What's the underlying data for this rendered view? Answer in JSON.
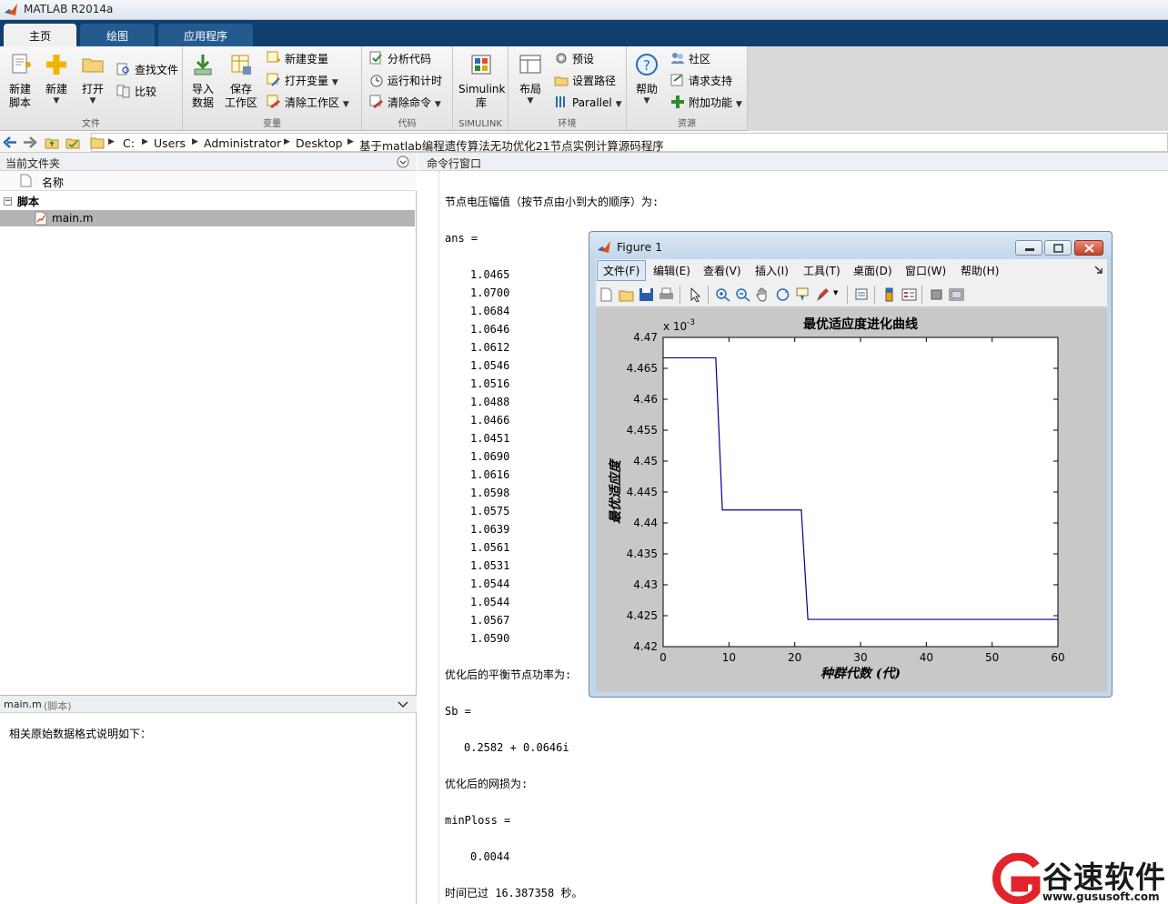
{
  "app": {
    "title": "MATLAB R2014a"
  },
  "tabs": [
    {
      "label": "主页",
      "active": true
    },
    {
      "label": "绘图",
      "active": false
    },
    {
      "label": "应用程序",
      "active": false
    }
  ],
  "ribbon": {
    "file": {
      "label": "文件",
      "new_script": [
        "新建",
        "脚本"
      ],
      "new": "新建",
      "open": "打开",
      "find_files": "查找文件",
      "compare": "比较"
    },
    "variable": {
      "label": "变量",
      "import": [
        "导入",
        "数据"
      ],
      "save_ws": [
        "保存",
        "工作区"
      ],
      "new_var": "新建变量",
      "open_var": "打开变量",
      "clear_ws": "清除工作区"
    },
    "code": {
      "label": "代码",
      "analyze": "分析代码",
      "run_time": "运行和计时",
      "clear_cmd": "清除命令"
    },
    "simulink": {
      "label": "SIMULINK",
      "btn": [
        "Simulink",
        "库"
      ]
    },
    "env": {
      "label": "环境",
      "layout": "布局",
      "prefs": "预设",
      "set_path": "设置路径",
      "parallel": "Parallel"
    },
    "resources": {
      "label": "资源",
      "help": "帮助",
      "community": "社区",
      "support": "请求支持",
      "addons": "附加功能"
    }
  },
  "address": {
    "crumbs": [
      "C:",
      "Users",
      "Administrator",
      "Desktop",
      "基于matlab编程遗传算法无功优化21节点实例计算源码程序"
    ]
  },
  "file_browser": {
    "title": "当前文件夹",
    "column_name": "名称",
    "group": "脚本",
    "file": "main.m"
  },
  "details": {
    "header_name": "main.m",
    "header_type": "(脚本)",
    "text": "相关原始数据格式说明如下："
  },
  "command_window": {
    "title": "命令行窗口",
    "heading": "节点电压幅值（按节点由小到大的顺序）为:",
    "ans_label": "ans =",
    "voltages": [
      "1.0465",
      "1.0700",
      "1.0684",
      "1.0646",
      "1.0612",
      "1.0546",
      "1.0516",
      "1.0488",
      "1.0466",
      "1.0451",
      "1.0690",
      "1.0616",
      "1.0598",
      "1.0575",
      "1.0639",
      "1.0561",
      "1.0531",
      "1.0544",
      "1.0544",
      "1.0567",
      "1.0590"
    ],
    "balance_heading": "优化后的平衡节点功率为:",
    "sb_label": "Sb =",
    "sb_value": "0.2582 + 0.0646i",
    "loss_heading": "优化后的网损为:",
    "loss_label": "minPloss =",
    "loss_value": "0.0044",
    "elapsed": "时间已过 16.387358 秒。"
  },
  "figure": {
    "title": "Figure 1",
    "menu": [
      "文件(F)",
      "编辑(E)",
      "查看(V)",
      "插入(I)",
      "工具(T)",
      "桌面(D)",
      "窗口(W)",
      "帮助(H)"
    ]
  },
  "chart_data": {
    "type": "line",
    "title": "最优适应度进化曲线",
    "xlabel": "种群代数 (代)",
    "ylabel": "最优适应度",
    "y_exponent_label": "x 10",
    "y_exponent": "-3",
    "xlim": [
      0,
      60
    ],
    "ylim": [
      4.42,
      4.47
    ],
    "xticks": [
      "0",
      "10",
      "20",
      "30",
      "40",
      "50",
      "60"
    ],
    "yticks": [
      "4.42",
      "4.425",
      "4.43",
      "4.435",
      "4.44",
      "4.445",
      "4.45",
      "4.455",
      "4.46",
      "4.465",
      "4.47"
    ],
    "series": [
      {
        "color": "#00008b",
        "x": [
          0,
          8,
          9,
          21,
          22,
          60
        ],
        "y": [
          4.4667,
          4.4667,
          4.4421,
          4.4421,
          4.4244,
          4.4244
        ]
      }
    ]
  },
  "watermark": {
    "brand": "谷速软件",
    "url": "www.gususoft.com"
  }
}
